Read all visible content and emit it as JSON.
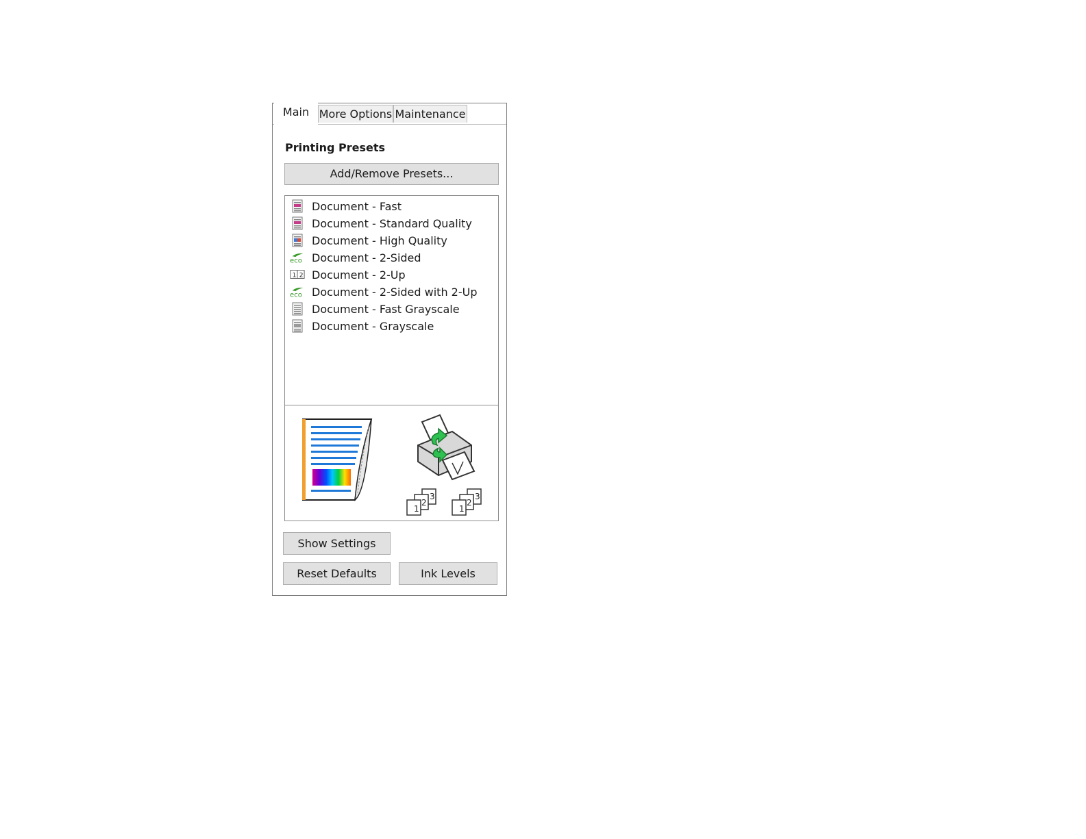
{
  "tabs": [
    {
      "label": "Main",
      "active": true
    },
    {
      "label": "More Options",
      "active": false
    },
    {
      "label": "Maintenance",
      "active": false
    }
  ],
  "printing_presets": {
    "title": "Printing Presets",
    "add_remove_label": "Add/Remove Presets...",
    "items": [
      {
        "label": "Document - Fast",
        "icon": "document-color-icon"
      },
      {
        "label": "Document - Standard Quality",
        "icon": "document-color-icon"
      },
      {
        "label": "Document - High Quality",
        "icon": "document-photo-icon"
      },
      {
        "label": "Document - 2-Sided",
        "icon": "eco-icon"
      },
      {
        "label": "Document - 2-Up",
        "icon": "two-up-icon"
      },
      {
        "label": "Document - 2-Sided with 2-Up",
        "icon": "eco-icon"
      },
      {
        "label": "Document - Fast Grayscale",
        "icon": "document-gray-icon"
      },
      {
        "label": "Document - Grayscale",
        "icon": "document-gray-photo-icon"
      }
    ]
  },
  "preview": {
    "page_icon": "color-document-preview-icon",
    "printer_icon": "duplex-printer-icon",
    "collate_icon": "collated-pages-icon",
    "collate_labels": [
      "1",
      "2",
      "3"
    ]
  },
  "buttons": {
    "show_settings": "Show Settings",
    "reset_defaults": "Reset Defaults",
    "ink_levels": "Ink Levels"
  },
  "colors": {
    "eco_green": "#3a9a2a",
    "preview_blue": "#1e78d8",
    "preview_orange": "#f0a030",
    "arrow_green": "#2ec050"
  }
}
